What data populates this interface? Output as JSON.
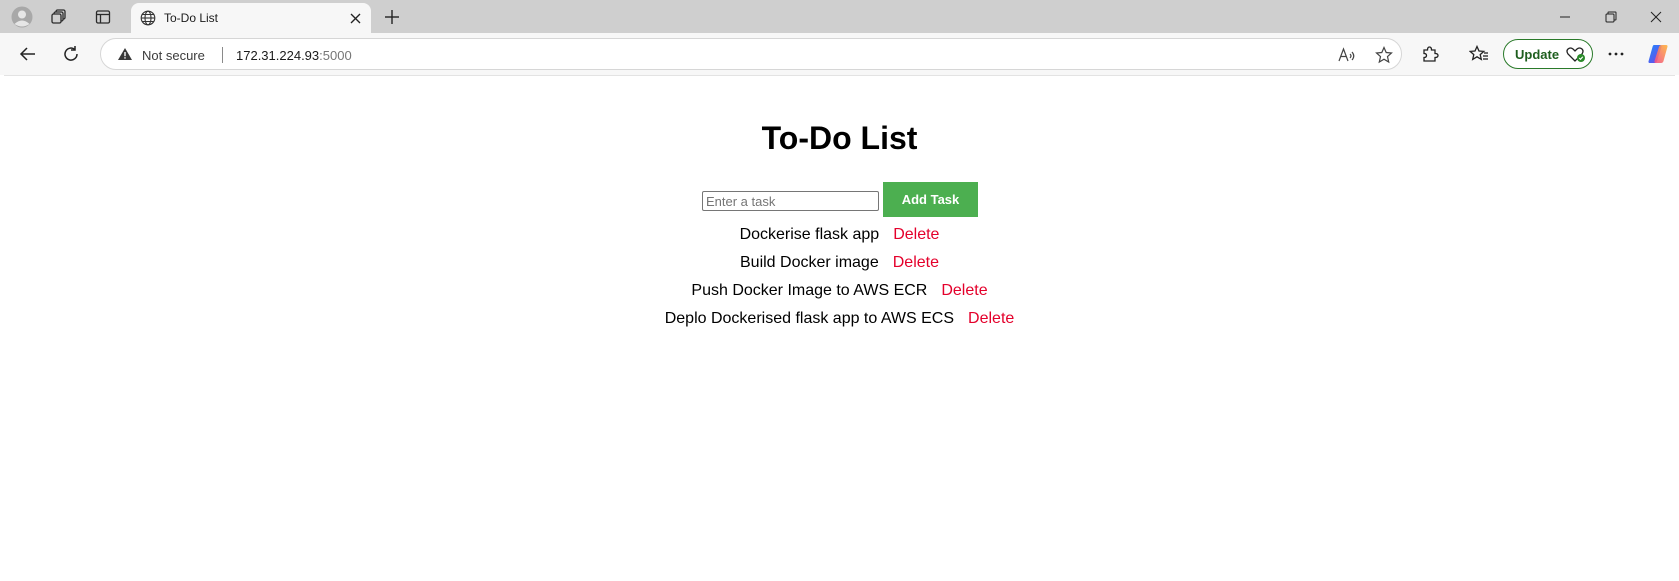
{
  "browser": {
    "tab": {
      "title": "To-Do List"
    },
    "address": {
      "security_label": "Not secure",
      "host": "172.31.224.93",
      "port": ":5000"
    },
    "update_label": "Update"
  },
  "page": {
    "title": "To-Do List",
    "input": {
      "placeholder": "Enter a task",
      "value": ""
    },
    "add_button_label": "Add Task",
    "tasks": [
      {
        "text": "Dockerise flask app",
        "action": "Delete"
      },
      {
        "text": "Build Docker image",
        "action": "Delete"
      },
      {
        "text": "Push Docker Image to AWS ECR",
        "action": "Delete"
      },
      {
        "text": "Deplo Dockerised flask app to AWS ECS",
        "action": "Delete"
      }
    ]
  },
  "colors": {
    "add_button": "#4caf50",
    "delete_link": "#e4002b",
    "update_border": "#2a7a2a"
  },
  "icons": [
    "profile-icon",
    "workspaces-icon",
    "tab-actions-icon",
    "globe-icon",
    "close-icon",
    "plus-icon",
    "minimize-icon",
    "restore-icon",
    "window-close-icon",
    "back-icon",
    "refresh-icon",
    "warning-icon",
    "read-aloud-icon",
    "favorite-star-icon",
    "extensions-icon",
    "favorites-icon",
    "update-heart-icon",
    "more-icon",
    "copilot-icon"
  ]
}
